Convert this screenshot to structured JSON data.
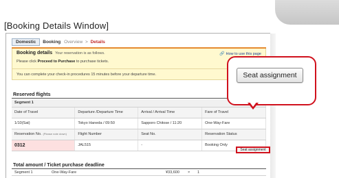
{
  "caption": "[Booking Details Window]",
  "tabs": {
    "domestic": "Domestic"
  },
  "breadcrumb": {
    "main": "Booking",
    "step1": "Overview",
    "sep": ">",
    "current": "Details"
  },
  "details": {
    "title": "Booking details",
    "subtitle": "Your reservation is as follows.",
    "help_link": "How to use this page",
    "line2_prefix": "Please click ",
    "line2_bold": "Proceed to Purchase",
    "line2_suffix": " to purchase tickets.",
    "checkin_note": "You can complete your check-in procedures 15 minutes before your departure time."
  },
  "reserved_flights": {
    "title": "Reserved flights",
    "segment_label": "Segment 1",
    "headers": [
      "Date of Travel",
      "Departure /Departure Time",
      "Arrival / Arrival Time",
      "Fare of Travel"
    ],
    "row1": [
      "1/10(Sat)",
      "Tokyo Haneda / 09:50",
      "Sapporo Chitose / 11:20",
      "One-Way-Fare"
    ],
    "headers2": [
      "Reservation No.",
      "Flight Number",
      "Seat No.",
      "Reservation Status"
    ],
    "headers2_note": "(Please note down)",
    "row2": [
      "0312",
      "JAL515",
      "-",
      "Booking Only"
    ]
  },
  "seat_assignment_small": "Seat assignment",
  "seat_assignment_large": "Seat assignment",
  "total": {
    "title": "Total amount / Ticket purchase deadline",
    "segment": "Segment 1",
    "fare": "One-Way-Fare",
    "amount": "¥33,600",
    "times": "×",
    "qty": "1"
  },
  "colors": {
    "accent_red": "#d0101c",
    "orange_rule": "#e58a2e",
    "notice_bg": "#fff9cf"
  }
}
